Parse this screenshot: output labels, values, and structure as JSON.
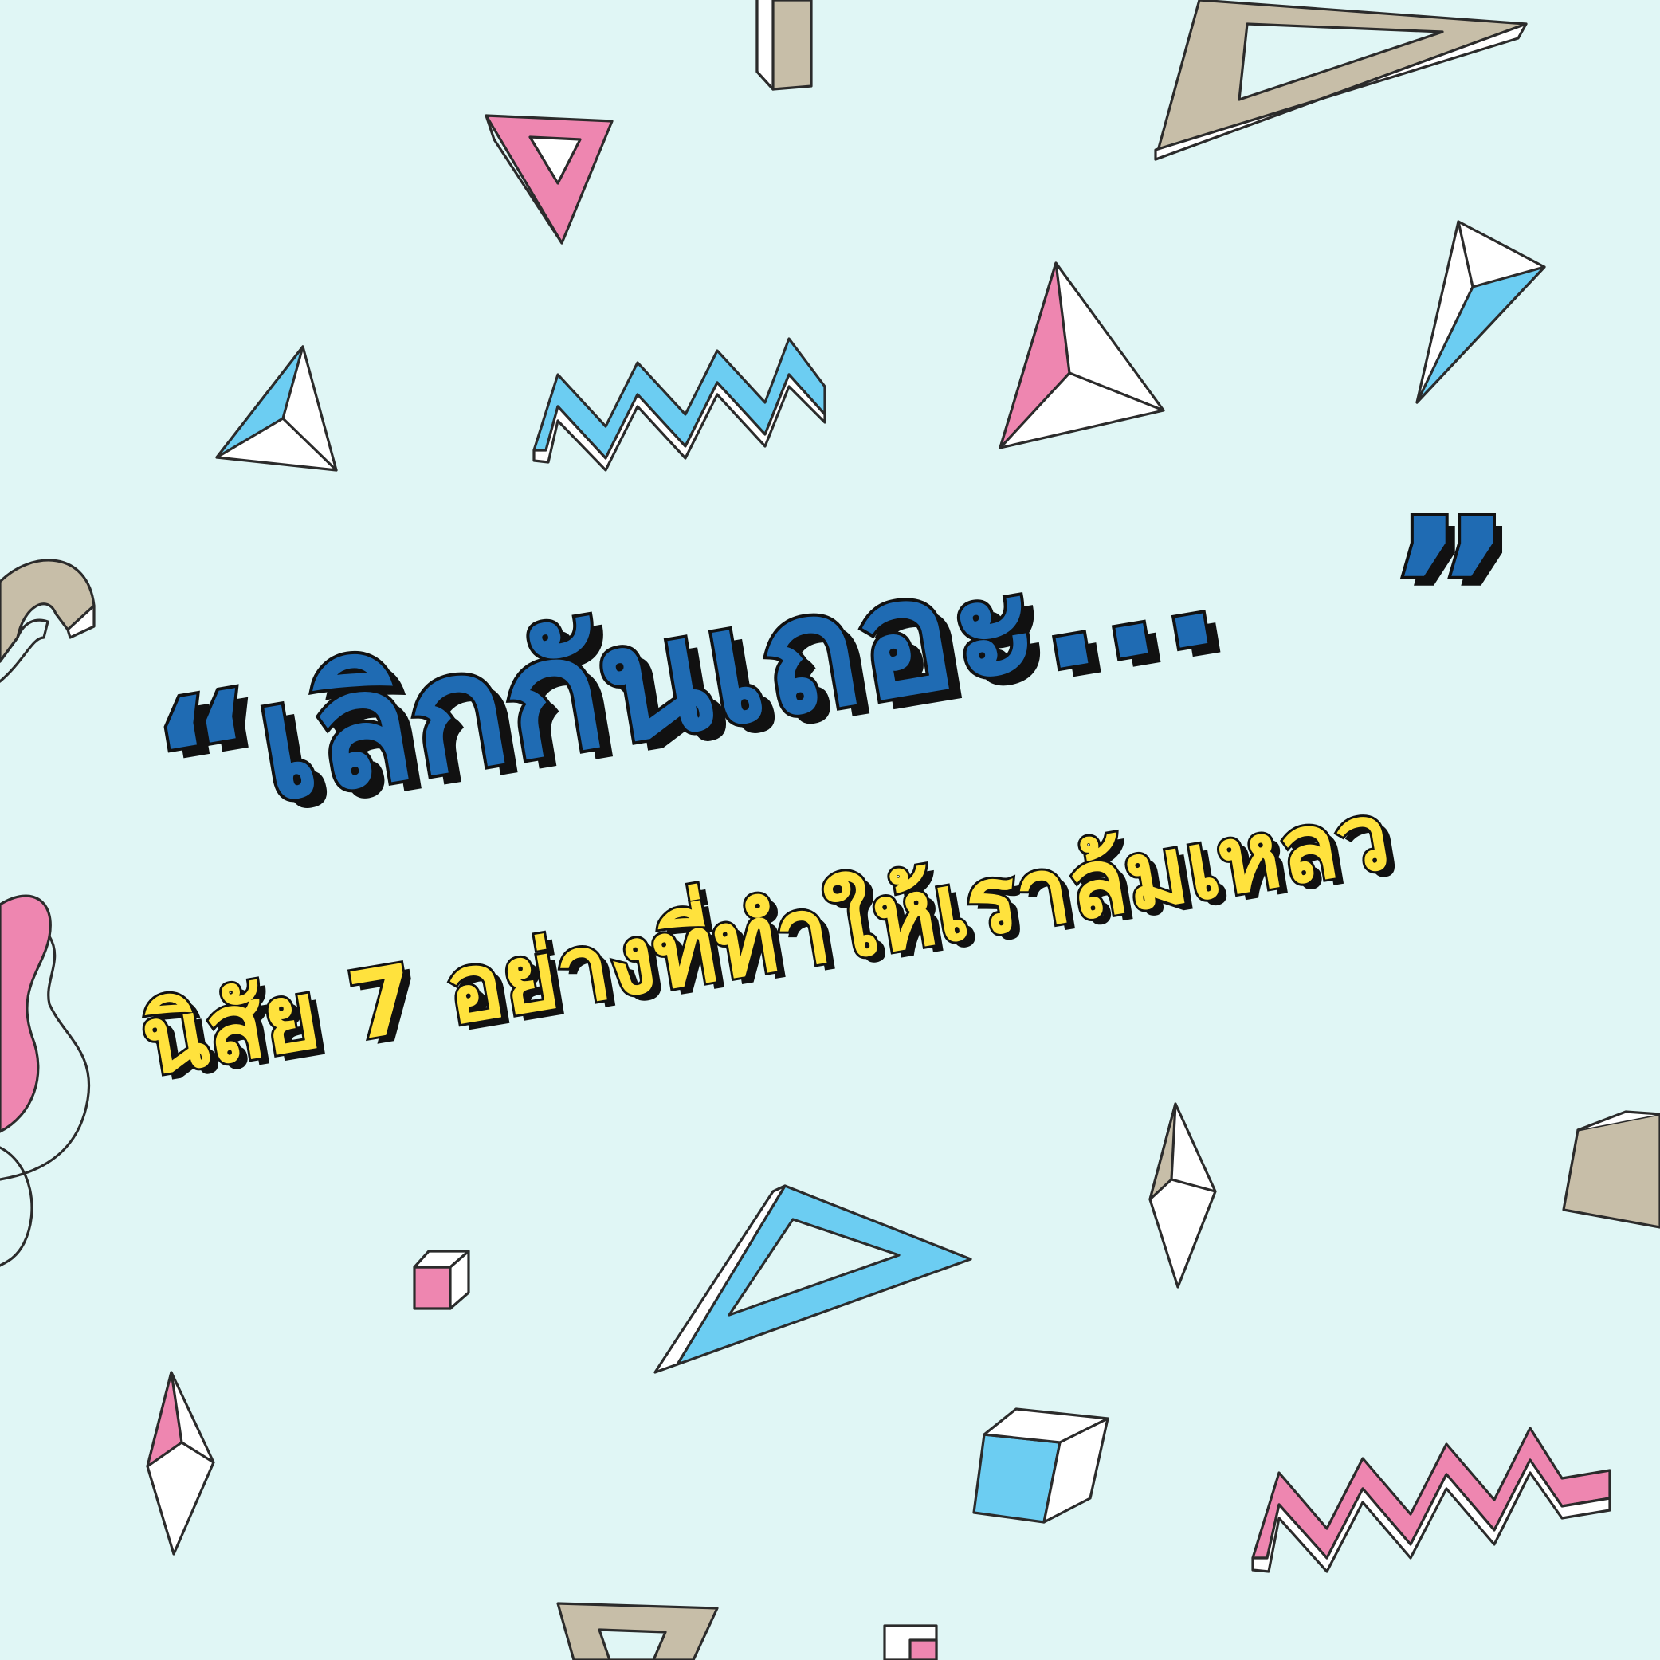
{
  "poster": {
    "headline": "“เลิกกันเถอะ...",
    "closing_quote": "”",
    "subheadline": "นิสัย 7 อย่างที่ทำให้เราล้มเหลว"
  },
  "colors": {
    "background": "#e0f6f5",
    "headline_fill": "#1f6bb3",
    "subheadline_fill": "#ffe23d",
    "outline": "#111111",
    "accent_pink": "#ee86b0",
    "accent_blue": "#6ccdf2",
    "accent_tan": "#c7bea8"
  },
  "decorations": [
    "pink-triangle-icon",
    "tan-triangle-icon",
    "blue-pyramid-icon",
    "pink-pyramid-icon",
    "blue-zigzag-icon",
    "pink-zigzag-icon",
    "tan-swirl-icon",
    "pink-swirl-icon",
    "blue-triangle-frame-icon",
    "tan-diamond-icon",
    "pink-diamond-icon",
    "blue-cube-icon",
    "tan-cube-icon",
    "pink-cube-icon"
  ]
}
